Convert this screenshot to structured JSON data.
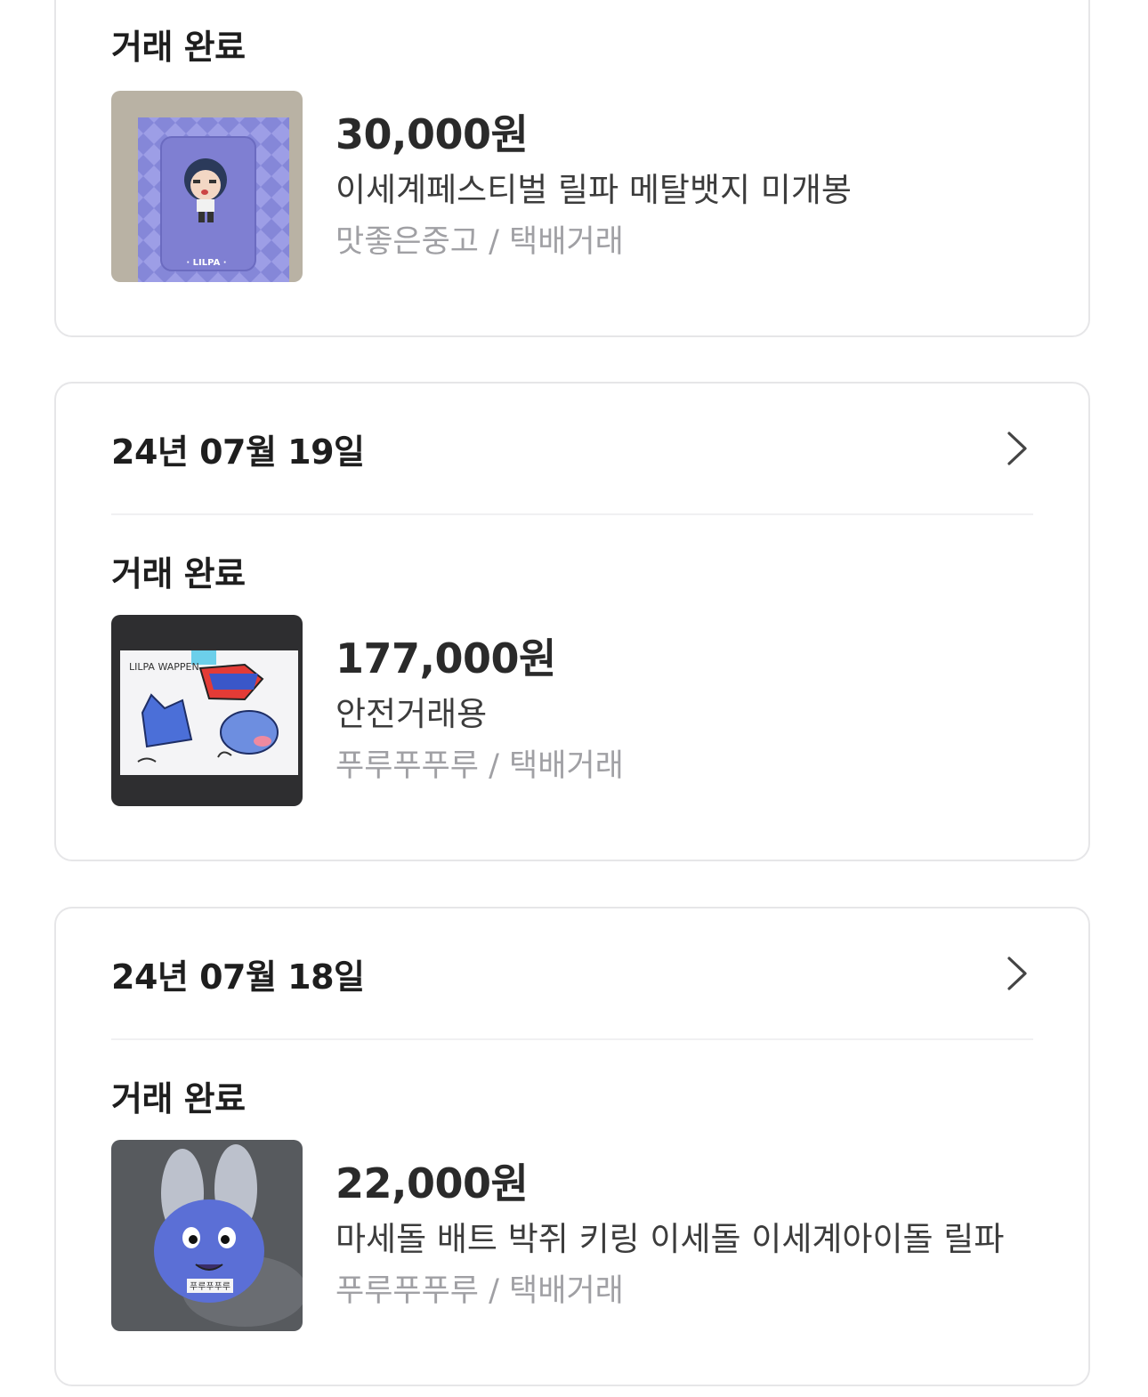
{
  "transactions": [
    {
      "date": "",
      "status": "거래 완료",
      "price": "30,000원",
      "title": "이세계페스티벌 릴파 메탈뱃지 미개봉",
      "meta": "맛좋은중고 / 택배거래",
      "thumbnail_text": "· LILPA ·"
    },
    {
      "date": "24년 07월 19일",
      "status": "거래 완료",
      "price": "177,000원",
      "title": "안전거래용",
      "meta": "푸루푸푸루 / 택배거래",
      "thumbnail_text": "LILPA WAPPEN"
    },
    {
      "date": "24년 07월 18일",
      "status": "거래 완료",
      "price": "22,000원",
      "title": "마세돌 배트 박쥐 키링 이세돌 이세계아이돌 릴파",
      "meta": "푸루푸푸루 / 택배거래",
      "thumbnail_text": "푸루푸푸루"
    }
  ],
  "icons": {
    "chevron": "chevron-right-icon"
  },
  "colors": {
    "card_border": "#e6e6e8",
    "meta_text": "#a0a0a4",
    "primary_text": "#1e1e1e"
  }
}
